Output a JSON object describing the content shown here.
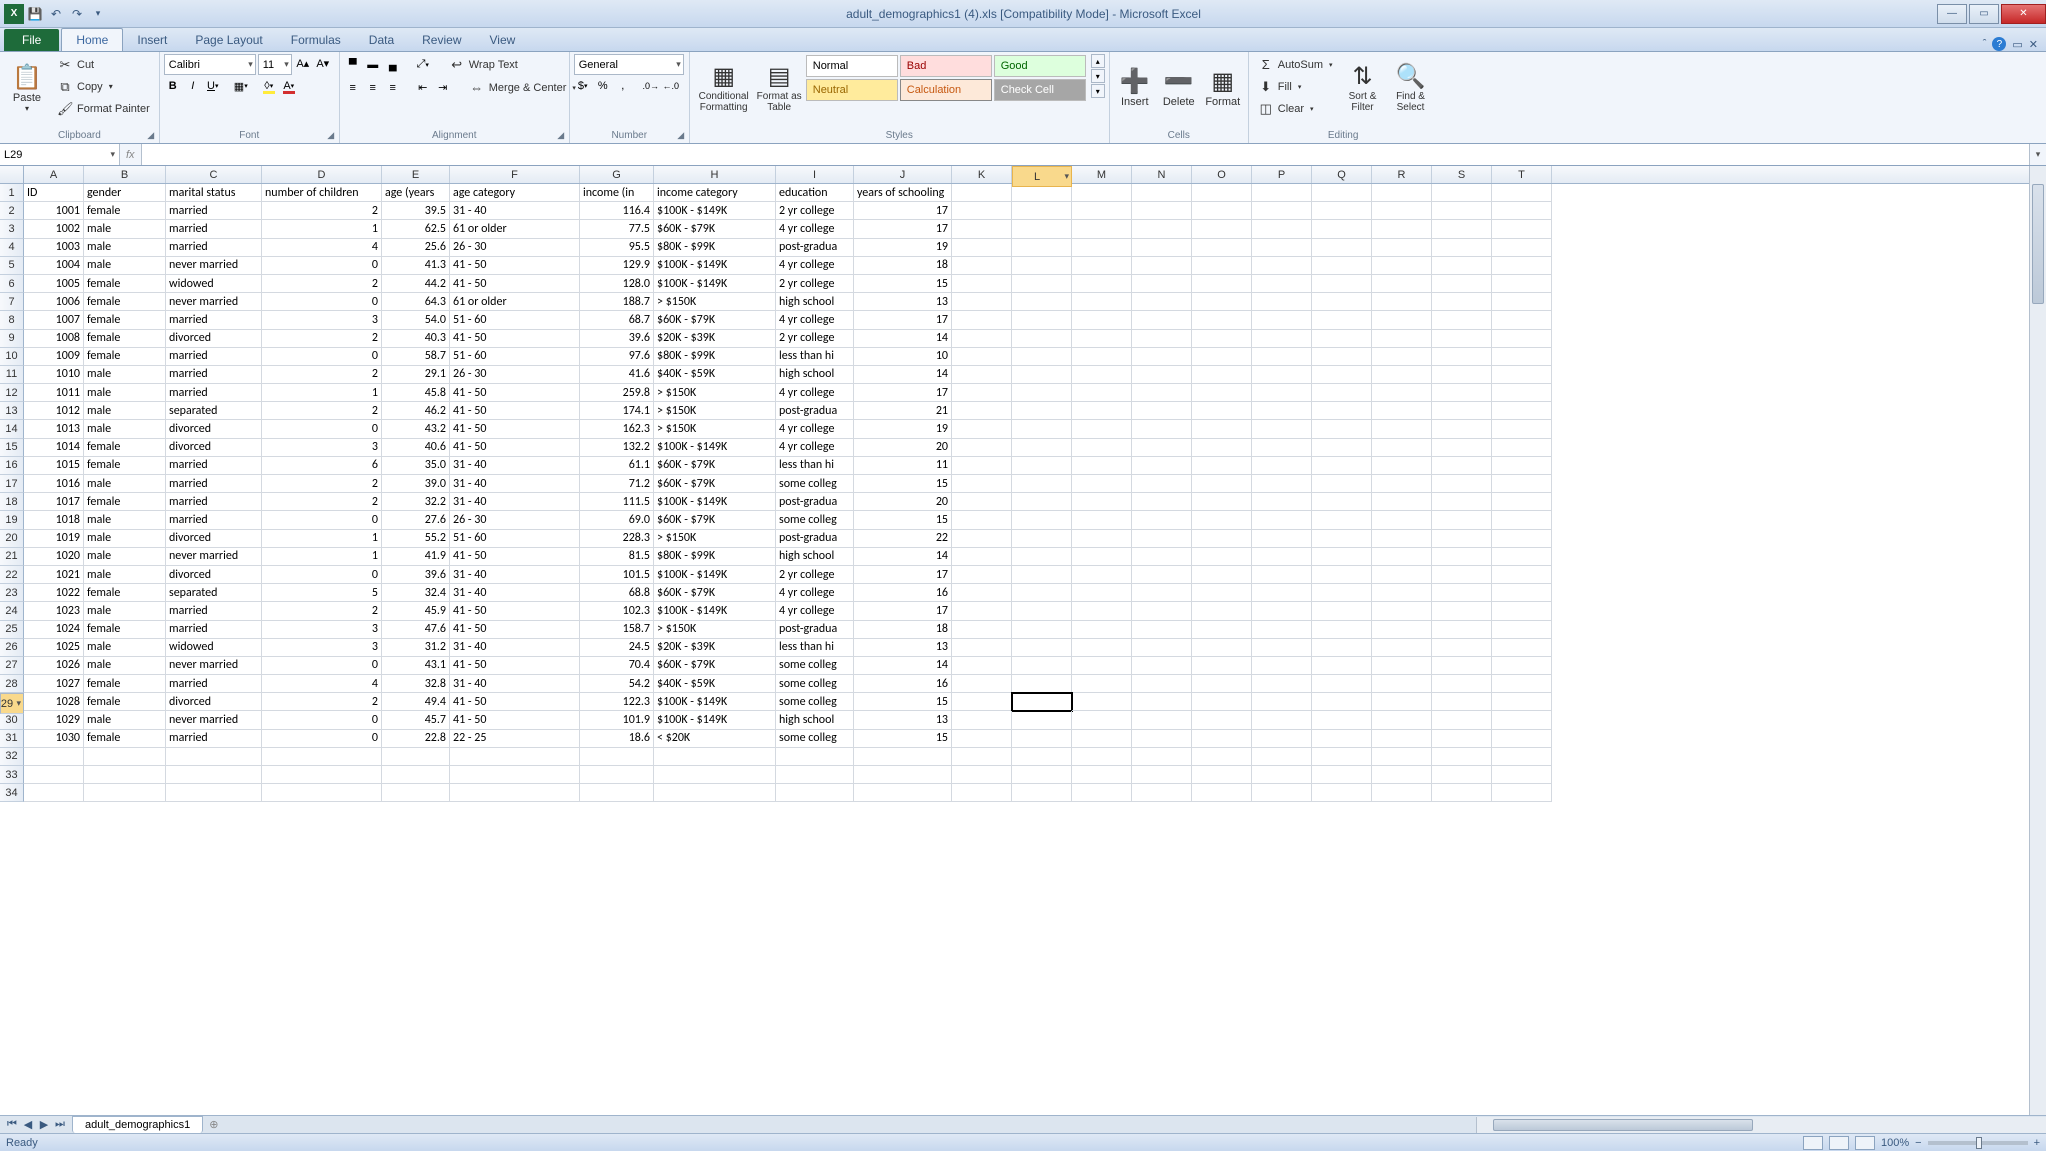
{
  "window": {
    "title": "adult_demographics1 (4).xls  [Compatibility Mode] - Microsoft Excel"
  },
  "tabs": {
    "file": "File",
    "home": "Home",
    "insert": "Insert",
    "pagelayout": "Page Layout",
    "formulas": "Formulas",
    "data": "Data",
    "review": "Review",
    "view": "View"
  },
  "ribbon": {
    "clipboard": {
      "paste": "Paste",
      "cut": "Cut",
      "copy": "Copy",
      "painter": "Format Painter",
      "label": "Clipboard"
    },
    "font": {
      "name": "Calibri",
      "size": "11",
      "label": "Font"
    },
    "alignment": {
      "wrap": "Wrap Text",
      "merge": "Merge & Center",
      "label": "Alignment"
    },
    "number": {
      "format": "General",
      "label": "Number"
    },
    "styles": {
      "cond": "Conditional Formatting",
      "table": "Format as Table",
      "normal": "Normal",
      "bad": "Bad",
      "good": "Good",
      "neutral": "Neutral",
      "calc": "Calculation",
      "check": "Check Cell",
      "label": "Styles"
    },
    "cells": {
      "insert": "Insert",
      "delete": "Delete",
      "format": "Format",
      "label": "Cells"
    },
    "editing": {
      "autosum": "AutoSum",
      "fill": "Fill",
      "clear": "Clear",
      "sort": "Sort & Filter",
      "find": "Find & Select",
      "label": "Editing"
    }
  },
  "namebox": "L29",
  "formula": "",
  "sheettab": "adult_demographics1",
  "status": {
    "ready": "Ready",
    "zoom": "100%"
  },
  "colWidths": {
    "A": 60,
    "B": 82,
    "C": 96,
    "D": 120,
    "E": 68,
    "F": 130,
    "G": 74,
    "H": 122,
    "I": 78,
    "J": 98,
    "K": 60,
    "L": 60,
    "M": 60,
    "N": 60,
    "O": 60,
    "P": 60,
    "Q": 60,
    "R": 60,
    "S": 60,
    "T": 60
  },
  "headers": [
    "ID",
    "gender",
    "marital status",
    "number of children",
    "age (years",
    "age category",
    "income (in",
    "income category",
    "education",
    "years of schooling"
  ],
  "selectedCell": {
    "row": 29,
    "col": "L"
  },
  "rows": [
    [
      1001,
      "female",
      "married",
      2,
      39.5,
      "31 - 40",
      116.4,
      "$100K - $149K",
      "2 yr college",
      17
    ],
    [
      1002,
      "male",
      "married",
      1,
      62.5,
      "61 or older",
      77.5,
      "$60K - $79K",
      "4 yr college",
      17
    ],
    [
      1003,
      "male",
      "married",
      4,
      25.6,
      "26 - 30",
      95.5,
      "$80K - $99K",
      "post-gradua",
      19
    ],
    [
      1004,
      "male",
      "never married",
      0,
      41.3,
      "41 - 50",
      129.9,
      "$100K - $149K",
      "4 yr college",
      18
    ],
    [
      1005,
      "female",
      "widowed",
      2,
      44.2,
      "41 - 50",
      128.0,
      "$100K - $149K",
      "2 yr college",
      15
    ],
    [
      1006,
      "female",
      "never married",
      0,
      64.3,
      "61 or older",
      188.7,
      "> $150K",
      "high school",
      13
    ],
    [
      1007,
      "female",
      "married",
      3,
      54.0,
      "51 - 60",
      68.7,
      "$60K - $79K",
      "4 yr college",
      17
    ],
    [
      1008,
      "female",
      "divorced",
      2,
      40.3,
      "41 - 50",
      39.6,
      "$20K - $39K",
      "2 yr college",
      14
    ],
    [
      1009,
      "female",
      "married",
      0,
      58.7,
      "51 - 60",
      97.6,
      "$80K - $99K",
      "less than hi",
      10
    ],
    [
      1010,
      "male",
      "married",
      2,
      29.1,
      "26 - 30",
      41.6,
      "$40K - $59K",
      "high school",
      14
    ],
    [
      1011,
      "male",
      "married",
      1,
      45.8,
      "41 - 50",
      259.8,
      "> $150K",
      "4 yr college",
      17
    ],
    [
      1012,
      "male",
      "separated",
      2,
      46.2,
      "41 - 50",
      174.1,
      "> $150K",
      "post-gradua",
      21
    ],
    [
      1013,
      "male",
      "divorced",
      0,
      43.2,
      "41 - 50",
      162.3,
      "> $150K",
      "4 yr college",
      19
    ],
    [
      1014,
      "female",
      "divorced",
      3,
      40.6,
      "41 - 50",
      132.2,
      "$100K - $149K",
      "4 yr college",
      20
    ],
    [
      1015,
      "female",
      "married",
      6,
      35.0,
      "31 - 40",
      61.1,
      "$60K - $79K",
      "less than hi",
      11
    ],
    [
      1016,
      "male",
      "married",
      2,
      39.0,
      "31 - 40",
      71.2,
      "$60K - $79K",
      "some colleg",
      15
    ],
    [
      1017,
      "female",
      "married",
      2,
      32.2,
      "31 - 40",
      111.5,
      "$100K - $149K",
      "post-gradua",
      20
    ],
    [
      1018,
      "male",
      "married",
      0,
      27.6,
      "26 - 30",
      69.0,
      "$60K - $79K",
      "some colleg",
      15
    ],
    [
      1019,
      "male",
      "divorced",
      1,
      55.2,
      "51 - 60",
      228.3,
      "> $150K",
      "post-gradua",
      22
    ],
    [
      1020,
      "male",
      "never married",
      1,
      41.9,
      "41 - 50",
      81.5,
      "$80K - $99K",
      "high school",
      14
    ],
    [
      1021,
      "male",
      "divorced",
      0,
      39.6,
      "31 - 40",
      101.5,
      "$100K - $149K",
      "2 yr college",
      17
    ],
    [
      1022,
      "female",
      "separated",
      5,
      32.4,
      "31 - 40",
      68.8,
      "$60K - $79K",
      "4 yr college",
      16
    ],
    [
      1023,
      "male",
      "married",
      2,
      45.9,
      "41 - 50",
      102.3,
      "$100K - $149K",
      "4 yr college",
      17
    ],
    [
      1024,
      "female",
      "married",
      3,
      47.6,
      "41 - 50",
      158.7,
      "> $150K",
      "post-gradua",
      18
    ],
    [
      1025,
      "male",
      "widowed",
      3,
      31.2,
      "31 - 40",
      24.5,
      "$20K - $39K",
      "less than hi",
      13
    ],
    [
      1026,
      "male",
      "never married",
      0,
      43.1,
      "41 - 50",
      70.4,
      "$60K - $79K",
      "some colleg",
      14
    ],
    [
      1027,
      "female",
      "married",
      4,
      32.8,
      "31 - 40",
      54.2,
      "$40K - $59K",
      "some colleg",
      16
    ],
    [
      1028,
      "female",
      "divorced",
      2,
      49.4,
      "41 - 50",
      122.3,
      "$100K - $149K",
      "some colleg",
      15
    ],
    [
      1029,
      "male",
      "never married",
      0,
      45.7,
      "41 - 50",
      101.9,
      "$100K - $149K",
      "high school",
      13
    ],
    [
      1030,
      "female",
      "married",
      0,
      22.8,
      "22 - 25",
      18.6,
      "< $20K",
      "some colleg",
      15
    ]
  ]
}
